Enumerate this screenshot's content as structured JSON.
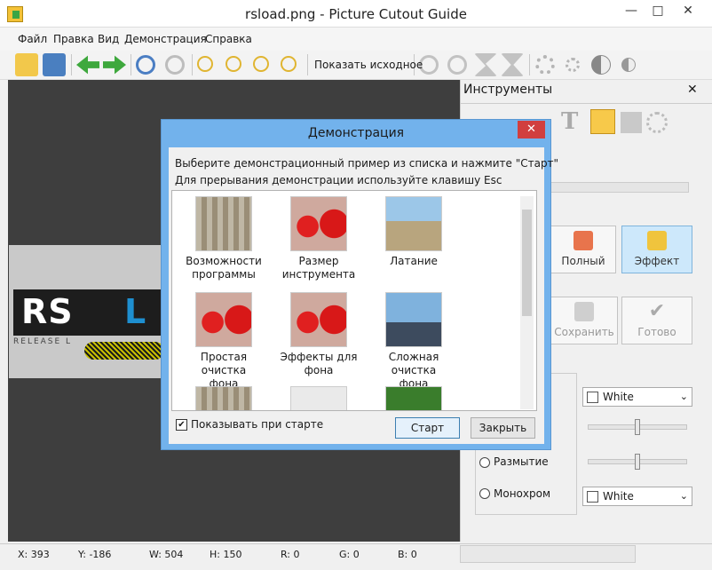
{
  "window": {
    "title": "rsload.png - Picture Cutout Guide"
  },
  "menu": [
    "Файл",
    "Правка",
    "Вид",
    "Демонстрация",
    "Справка"
  ],
  "toolbar": {
    "show_original": "Показать исходное"
  },
  "canvas_image": {
    "text_rs": "RS",
    "text_l": "L",
    "text_release": "RELEASE L"
  },
  "tools_panel": {
    "title": "Инструменты",
    "mode_full": "Полный",
    "mode_effect": "Эффект",
    "save": "Сохранить",
    "done": "Готово",
    "dropdown1": "White",
    "dropdown2": "White",
    "radio_blur": "Размытие",
    "radio_mono": "Монохром"
  },
  "dialog": {
    "title": "Демонстрация",
    "line1": "Выберите демонстрационный пример из списка и нажмите \"Старт\"",
    "line2": "Для прерывания демонстрации используйте клавишу Esc",
    "items": [
      {
        "label1": "Возможности",
        "label2": "программы"
      },
      {
        "label1": "Размер",
        "label2": "инструмента"
      },
      {
        "label1": "Латание",
        "label2": ""
      },
      {
        "label1": "Простая очистка",
        "label2": "фона"
      },
      {
        "label1": "Эффекты для",
        "label2": "фона"
      },
      {
        "label1": "Сложная очистка",
        "label2": "фона"
      }
    ],
    "show_on_start": "Показывать при старте",
    "start": "Старт",
    "close": "Закрыть"
  },
  "status": {
    "x": "X: 393",
    "y": "Y: -186",
    "w": "W: 504",
    "h": "H: 150",
    "r": "R: 0",
    "g": "G: 0",
    "b": "B: 0"
  }
}
